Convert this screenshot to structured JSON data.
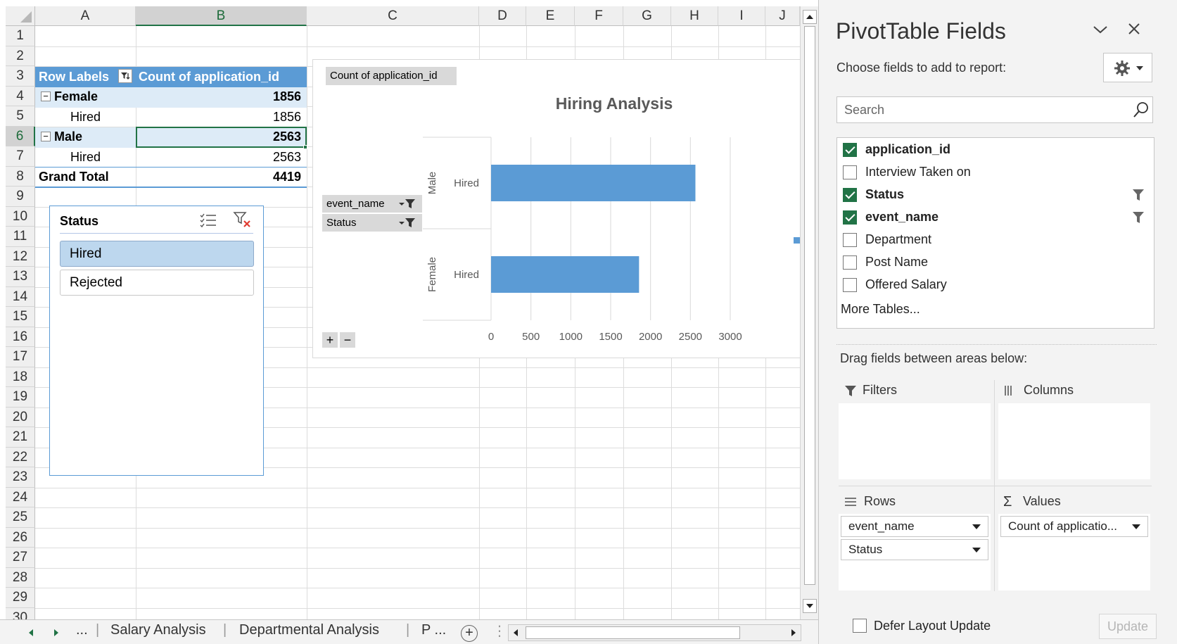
{
  "sheet": {
    "columns": [
      "A",
      "B",
      "C",
      "D",
      "E",
      "F",
      "G",
      "H",
      "I",
      "J"
    ],
    "rows": [
      "1",
      "2",
      "3",
      "4",
      "5",
      "6",
      "7",
      "8",
      "9",
      "10",
      "11",
      "12",
      "13",
      "14",
      "15",
      "16",
      "17",
      "18",
      "19",
      "20",
      "21",
      "22",
      "23",
      "24",
      "25",
      "26",
      "27",
      "28",
      "29",
      "30"
    ]
  },
  "pivot": {
    "header_row_labels": "Row Labels",
    "header_value": "Count of application_id",
    "rows": [
      {
        "label": "Female",
        "value": "1856",
        "level": 0
      },
      {
        "label": "Hired",
        "value": "1856",
        "level": 1
      },
      {
        "label": "Male",
        "value": "2563",
        "level": 0
      },
      {
        "label": "Hired",
        "value": "2563",
        "level": 1
      },
      {
        "label": "Grand Total",
        "value": "4419",
        "level": 0
      }
    ],
    "colors": {
      "header": "#5b9bd5",
      "band": "#ddebf7"
    }
  },
  "slicer": {
    "title": "Status",
    "items": [
      {
        "label": "Hired",
        "selected": true
      },
      {
        "label": "Rejected",
        "selected": false
      }
    ]
  },
  "chart": {
    "value_button": "Count  of application_id",
    "row_buttons": [
      "event_name",
      "Status"
    ],
    "expand_label": "+",
    "collapse_label": "−"
  },
  "chart_data": {
    "type": "bar",
    "orientation": "horizontal",
    "title": "Hiring Analysis",
    "groups": [
      "Male",
      "Female"
    ],
    "categories": [
      "Hired",
      "Hired"
    ],
    "values": [
      2563,
      1856
    ],
    "xlim": [
      0,
      3000
    ],
    "xticks": [
      0,
      500,
      1000,
      1500,
      2000,
      2500,
      3000
    ],
    "grid": true,
    "bar_color": "#5b9bd5"
  },
  "tabs": {
    "ellipsis_left": "...",
    "items": [
      "Salary Analysis",
      "Departmental Analysis",
      "P ..."
    ],
    "add": "+"
  },
  "panel": {
    "title": "PivotTable Fields",
    "choose_label": "Choose fields to add to report:",
    "search_placeholder": "Search",
    "fields": [
      {
        "label": "application_id",
        "checked": true,
        "filtered": false
      },
      {
        "label": "Interview Taken on",
        "checked": false,
        "filtered": false
      },
      {
        "label": "Status",
        "checked": true,
        "filtered": true
      },
      {
        "label": "event_name",
        "checked": true,
        "filtered": true
      },
      {
        "label": "Department",
        "checked": false,
        "filtered": false
      },
      {
        "label": "Post Name",
        "checked": false,
        "filtered": false
      },
      {
        "label": "Offered Salary",
        "checked": false,
        "filtered": false
      }
    ],
    "more_tables": "More Tables...",
    "drag_label": "Drag fields between areas below:",
    "areas": {
      "filters": "Filters",
      "columns": "Columns",
      "rows": "Rows",
      "values": "Values"
    },
    "row_fields": [
      "event_name",
      "Status"
    ],
    "value_fields": [
      "Count of applicatio..."
    ],
    "defer_label": "Defer Layout Update",
    "update_label": "Update"
  }
}
